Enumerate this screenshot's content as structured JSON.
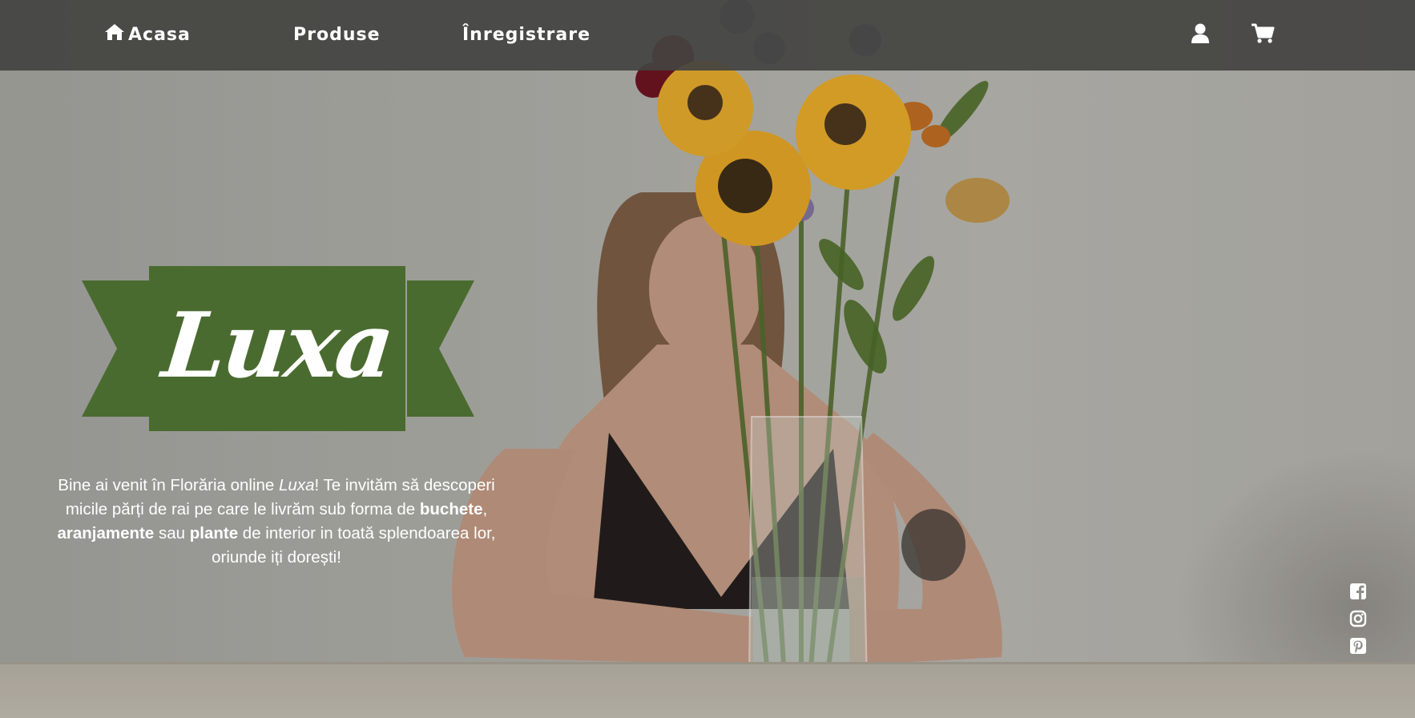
{
  "nav": {
    "home_label": "Acasa",
    "home_icon": "home-icon",
    "products_label": "Produse",
    "register_label": "Înregistrare",
    "user_icon": "user-icon",
    "cart_icon": "cart-icon"
  },
  "logo": {
    "text": "Luxa",
    "color": "#4a6b2f"
  },
  "intro": {
    "part1": "Bine ai venit în Florăria online ",
    "brand": "Luxa",
    "part2": "! Te invităm să descoperi micile părți de rai pe care le livrăm sub forma de ",
    "bold1": "buchete",
    "sep1": ", ",
    "bold2": "aranjamente",
    "sep2": " sau ",
    "bold3": "plante",
    "part3": " de interior in toată splendoarea lor, oriunde iți dorești!"
  },
  "social": [
    {
      "name": "facebook",
      "icon": "facebook-icon"
    },
    {
      "name": "instagram",
      "icon": "instagram-icon"
    },
    {
      "name": "pinterest",
      "icon": "pinterest-icon"
    }
  ],
  "colors": {
    "navbar": "#444442",
    "brand_green": "#4a6b2f",
    "text": "#ffffff"
  }
}
